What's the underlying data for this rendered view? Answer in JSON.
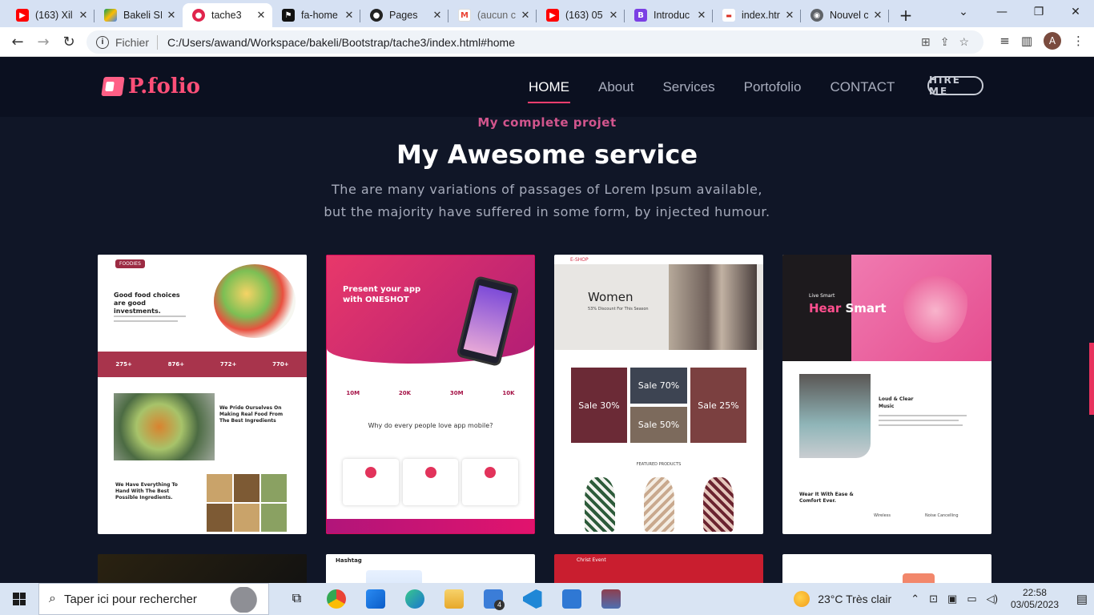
{
  "browser": {
    "tabs": [
      {
        "title": "(163) Xil",
        "icon": "youtube-icon",
        "color": "#ff0000"
      },
      {
        "title": "Bakeli SI",
        "icon": "drive-icon",
        "color": "#2a8bf2"
      },
      {
        "title": "tache3",
        "icon": "tache3-favicon",
        "color": "#e0244c",
        "active": true
      },
      {
        "title": "fa-home",
        "icon": "flag-icon",
        "color": "#111111"
      },
      {
        "title": "Pages",
        "icon": "github-icon",
        "color": "#222222"
      },
      {
        "title": "(aucun c",
        "icon": "gmail-icon",
        "color": "#ea4335"
      },
      {
        "title": "(163) 05",
        "icon": "youtube-icon",
        "color": "#ff0000"
      },
      {
        "title": "Introduc",
        "icon": "bootstrap-icon",
        "color": "#7b3fe4"
      },
      {
        "title": "index.htr",
        "icon": "file-icon",
        "color": "#d93025"
      },
      {
        "title": "Nouvel c",
        "icon": "chrome-icon",
        "color": "#5f6368"
      }
    ],
    "address": {
      "label": "Fichier",
      "url": "C:/Users/awand/Workspace/bakeli/Bootstrap/tache3/index.html#home"
    },
    "avatar_letter": "A"
  },
  "site": {
    "logo": "P.folio",
    "menu": [
      "HOME",
      "About",
      "Services",
      "Portofolio",
      "CONTACT"
    ],
    "hire": "HIRE ME",
    "section": {
      "kicker": "My complete projet",
      "title": "My Awesome service",
      "desc_line1": "The are many variations of passages of Lorem Ipsum available,",
      "desc_line2": "but the majority have suffered in some form, by injected humour."
    },
    "cards": {
      "foodies": {
        "badge": "FOODIES",
        "headline": "Good food choices are good investments.",
        "stats": [
          "275+",
          "876+",
          "772+",
          "770+"
        ],
        "text2": "We Pride Ourselves On Making Real Food From The Best Ingredients",
        "text3": "We Have Everything To Hand With The Best Possible Ingredients."
      },
      "oneshot": {
        "headline": "Present your app with ONESHOT",
        "stats": [
          "10M",
          "20K",
          "30M",
          "10K"
        ],
        "why": "Why do every people love app mobile?"
      },
      "eshop": {
        "brand": "E-SHOP",
        "title": "Women",
        "subtitle": "53% Discount For This Season",
        "sales": [
          "Sale 30%",
          "Sale 70%",
          "Sale 25%",
          "Sale 50%"
        ],
        "featured": "FEATURED PRODUCTS"
      },
      "headphones": {
        "kicker": "Live Smart",
        "title_a": "Hear",
        "title_b": "Smart",
        "section": "Loud & Clear Music",
        "wear": "Wear It With Ease & Comfort Ever.",
        "mini1": "Wireless",
        "mini2": "Noise Cancelling"
      },
      "row2": {
        "hashtag": "Hashtag",
        "christ": "Christ Event"
      }
    }
  },
  "taskbar": {
    "search_placeholder": "Taper ici pour rechercher",
    "weather": "23°C  Très clair",
    "time": "22:58",
    "date": "03/05/2023",
    "mail_badge": "4"
  }
}
